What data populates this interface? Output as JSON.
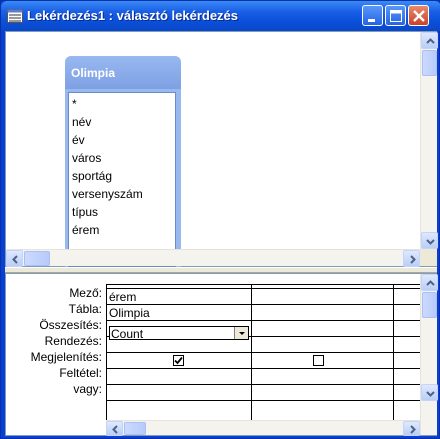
{
  "window": {
    "title": "Lekérdezés1 : választó lekérdezés"
  },
  "table_box": {
    "name": "Olimpia",
    "fields": [
      "*",
      "név",
      "év",
      "város",
      "sportág",
      "versenyszám",
      "típus",
      "érem"
    ]
  },
  "grid": {
    "row_labels": [
      "Mező:",
      "Tábla:",
      "Összesítés:",
      "Rendezés:",
      "Megjelenítés:",
      "Feltétel:",
      "vagy:"
    ],
    "column1": {
      "field": "érem",
      "table": "Olimpia",
      "total": "Count",
      "show": true
    },
    "column2": {
      "field": "",
      "table": "",
      "total": "",
      "show": false
    }
  },
  "colors": {
    "titlebar": "#0a4fd8",
    "table_header": "#98b8f0"
  }
}
